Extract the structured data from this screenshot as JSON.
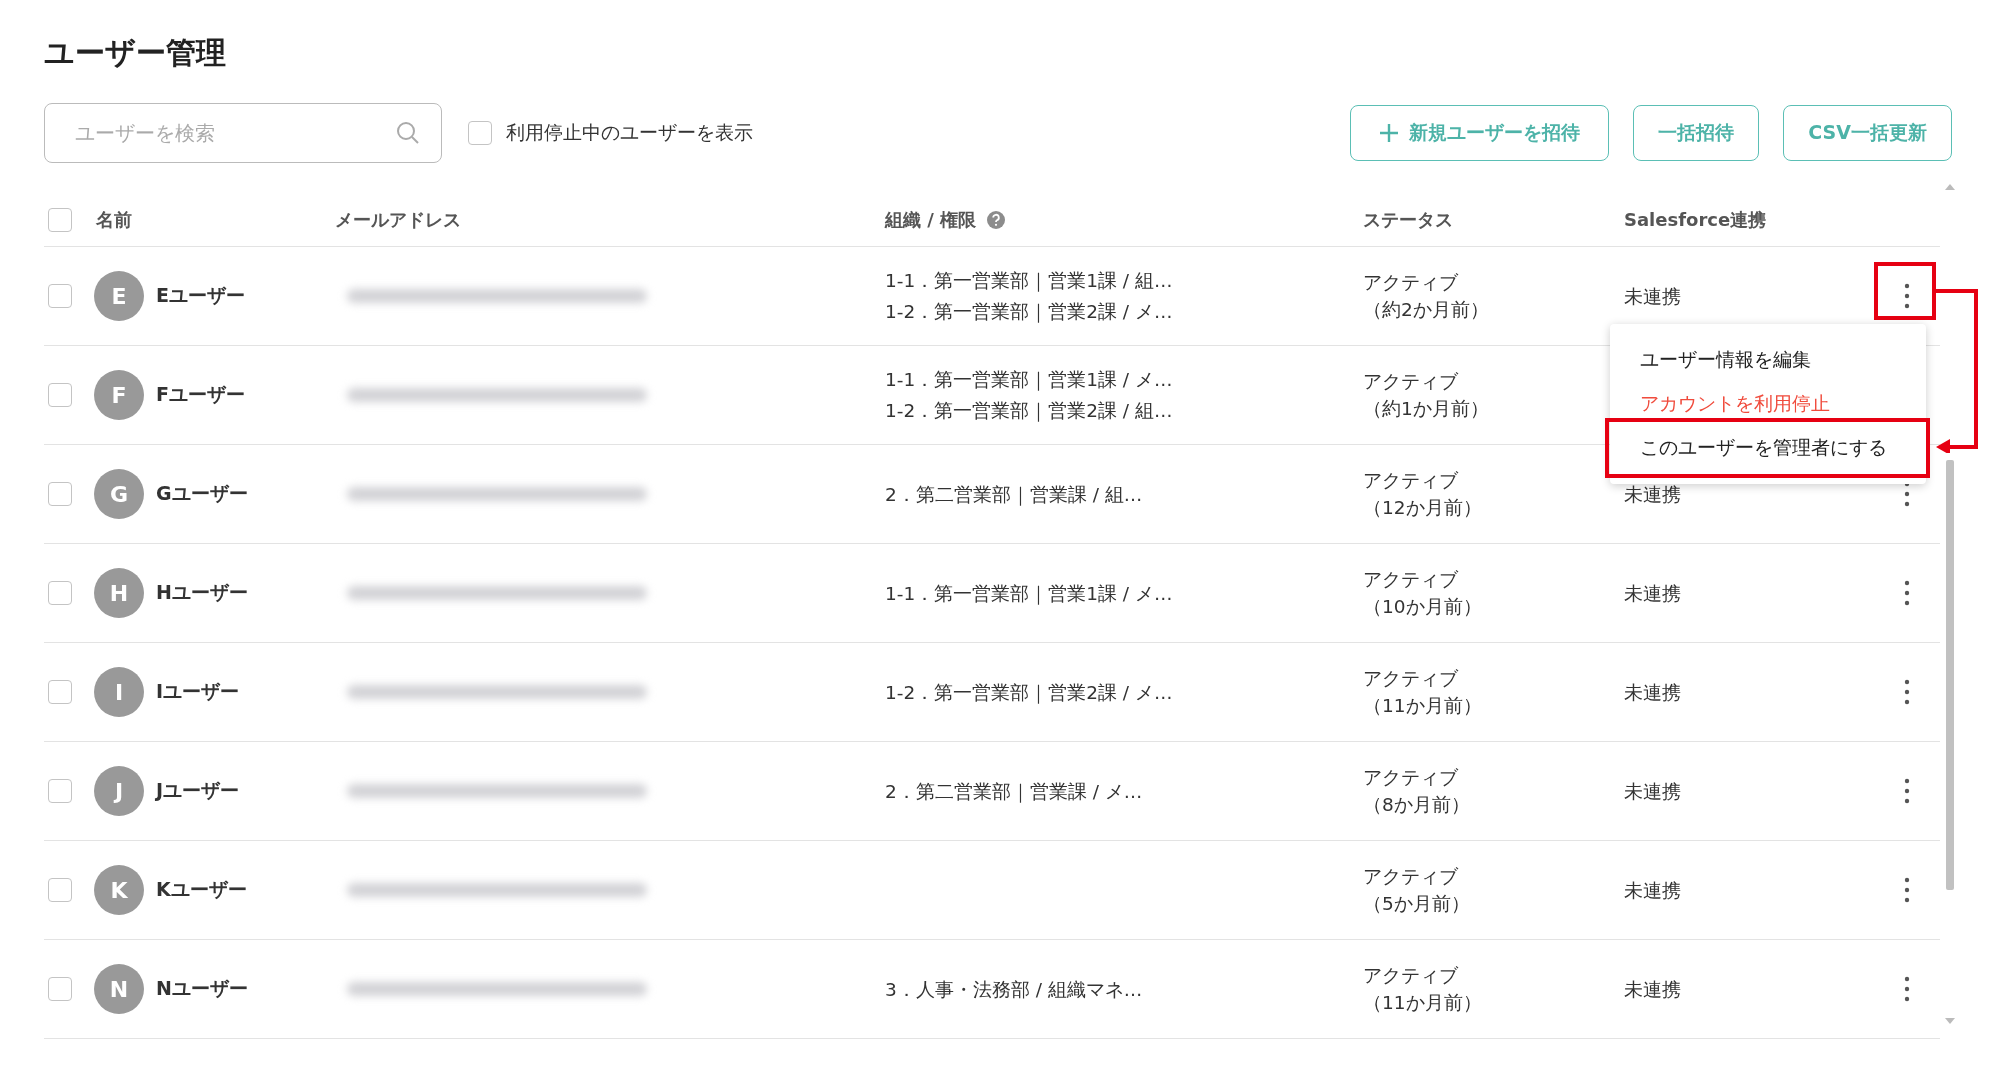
{
  "page": {
    "title": "ユーザー管理"
  },
  "toolbar": {
    "search": {
      "placeholder": "ユーザーを検索"
    },
    "show_suspended": {
      "label": "利用停止中のユーザーを表示",
      "checked": false
    },
    "buttons": [
      {
        "label": "新規ユーザーを招待",
        "kind": "add"
      },
      {
        "label": "一括招待",
        "kind": "plain"
      },
      {
        "label": "CSV一括更新",
        "kind": "plain"
      }
    ]
  },
  "table": {
    "select_all": {
      "checked": false
    },
    "columns": [
      {
        "label": "名前"
      },
      {
        "label": "メールアドレス"
      },
      {
        "label": "組織 / 権限",
        "help": true
      },
      {
        "label": "ステータス"
      },
      {
        "label": "Salesforce連携"
      }
    ],
    "rows": [
      {
        "initial": "E",
        "name": "Eユーザー",
        "checked": false,
        "org": [
          "1-1．第一営業部｜営業1課 / 組…",
          "1-2．第一営業部｜営業2課 / メ…"
        ],
        "status": "アクティブ",
        "status_age": "（約2か月前）",
        "salesforce": "未連携",
        "menu_open": true,
        "annotated": true
      },
      {
        "initial": "F",
        "name": "Fユーザー",
        "checked": false,
        "org": [
          "1-1．第一営業部｜営業1課 / メ…",
          "1-2．第一営業部｜営業2課 / 組…"
        ],
        "status": "アクティブ",
        "status_age": "（約1か月前）",
        "menu_open": false,
        "annotated": false,
        "hidden_actions": true
      },
      {
        "initial": "G",
        "name": "Gユーザー",
        "checked": false,
        "org": [
          "2．第二営業部｜営業課 / 組…"
        ],
        "status": "アクティブ",
        "status_age": "（12か月前）",
        "salesforce": "未連携",
        "menu_open": false,
        "annotated": false
      },
      {
        "initial": "H",
        "name": "Hユーザー",
        "checked": false,
        "org": [
          "1-1．第一営業部｜営業1課 / メ…"
        ],
        "status": "アクティブ",
        "status_age": "（10か月前）",
        "salesforce": "未連携",
        "menu_open": false,
        "annotated": false
      },
      {
        "initial": "I",
        "name": "Iユーザー",
        "checked": false,
        "org": [
          "1-2．第一営業部｜営業2課 / メ…"
        ],
        "status": "アクティブ",
        "status_age": "（11か月前）",
        "salesforce": "未連携",
        "menu_open": false,
        "annotated": false
      },
      {
        "initial": "J",
        "name": "Jユーザー",
        "checked": false,
        "org": [
          "2．第二営業部｜営業課 / メ…"
        ],
        "status": "アクティブ",
        "status_age": "（8か月前）",
        "salesforce": "未連携",
        "menu_open": false,
        "annotated": false
      },
      {
        "initial": "K",
        "name": "Kユーザー",
        "checked": false,
        "status": "アクティブ",
        "status_age": "（5か月前）",
        "salesforce": "未連携",
        "menu_open": false,
        "annotated": false
      },
      {
        "initial": "N",
        "name": "Nユーザー",
        "checked": false,
        "org": [
          "3．人事・法務部 / 組織マネ…"
        ],
        "status": "アクティブ",
        "status_age": "（11か月前）",
        "salesforce": "未連携",
        "menu_open": false,
        "annotated": false
      }
    ]
  },
  "row_menu": {
    "items": [
      {
        "label": "ユーザー情報を編集",
        "kind": "normal",
        "annotated": false
      },
      {
        "label": "アカウントを利用停止",
        "kind": "danger",
        "annotated": false
      },
      {
        "label": "このユーザーを管理者にする",
        "kind": "normal",
        "annotated": true
      }
    ]
  }
}
